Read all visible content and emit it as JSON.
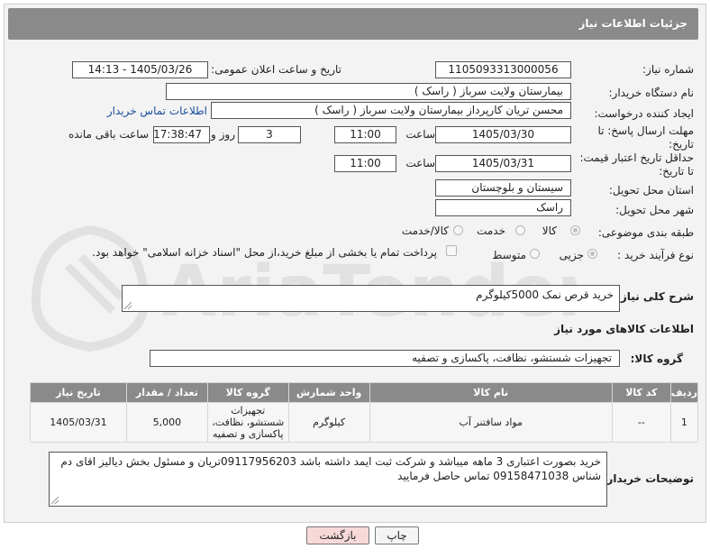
{
  "header": {
    "title": "جزئیات اطلاعات نیاز"
  },
  "labels": {
    "need_number": "شماره نیاز:",
    "announce_datetime": "تاریخ و ساعت اعلان عمومی:",
    "buyer_org": "نام دستگاه خریدار:",
    "requester": "ایجاد کننده درخواست:",
    "deadline": "مهلت ارسال پاسخ: تا تاریخ:",
    "price_validity": "حداقل تاریخ اعتبار قیمت: تا تاریخ:",
    "hour": "ساعت",
    "day_and": "روز و",
    "hours_remaining": "ساعت باقی مانده",
    "province": "استان محل تحویل:",
    "city": "شهر محل تحویل:",
    "subject_class": "طبقه بندی موضوعی:",
    "process_type": "نوع فرآیند خرید :",
    "need_summary": "شرح کلی نیاز:",
    "goods_info": "اطلاعات کالاهای مورد نیاز",
    "goods_group": "گروه کالا:",
    "buyer_notes": "توضیحات خریدار:"
  },
  "values": {
    "need_number": "1105093313000056",
    "announce_datetime": "1405/03/26 - 14:13",
    "buyer_org": "بیمارستان ولایت سرباز ( راسک )",
    "requester": "محسن تریان کارپرداز بیمارستان ولایت سرباز ( راسک )",
    "contact_link": "اطلاعات تماس خریدار",
    "deadline_date": "1405/03/30",
    "deadline_time": "11:00",
    "days_left": "3",
    "time_left": "17:38:47",
    "validity_date": "1405/03/31",
    "validity_time": "11:00",
    "province": "سیستان و بلوچستان",
    "city": "راسک",
    "need_summary": "خرید قرص نمک 5000کیلوگرم",
    "goods_group": "تجهیزات شستشو، نظافت، پاکسازی و تصفیه",
    "buyer_notes": "خرید بصورت اعتباری 3 ماهه میباشد و شرکت ثبت ایمد داشته باشد 09117956203تریان و مسئول بخش دیالیز اقای دم شناس 09158471038 تماس حاصل فرمایید"
  },
  "subject_options": [
    {
      "label": "کالا",
      "selected": true
    },
    {
      "label": "خدمت",
      "selected": false
    },
    {
      "label": "کالا/خدمت",
      "selected": false
    }
  ],
  "process_options": [
    {
      "label": "جزیی",
      "selected": true
    },
    {
      "label": "متوسط",
      "selected": false
    }
  ],
  "payment_note": "پرداخت تمام یا بخشی از مبلغ خرید،از محل \"اسناد خزانه اسلامی\" خواهد بود.",
  "table": {
    "headers": [
      "ردیف",
      "کد کالا",
      "نام کالا",
      "واحد شمارش",
      "گروه کالا",
      "تعداد / مقدار",
      "تاریخ نیاز"
    ],
    "rows": [
      [
        "1",
        "--",
        "مواد سافتنر آب",
        "کیلوگرم",
        "تجهیزات شستشو، نظافت، پاکسازی و تصفیه",
        "5,000",
        "1405/03/31"
      ]
    ]
  },
  "buttons": {
    "print": "چاپ",
    "back": "بازگشت"
  },
  "watermark": {
    "text": "AriaTender.net"
  },
  "colors": {
    "header_bg": "#8a8a8a",
    "link": "#1a4fa0",
    "back_button_bg": "#f7d9d9"
  }
}
